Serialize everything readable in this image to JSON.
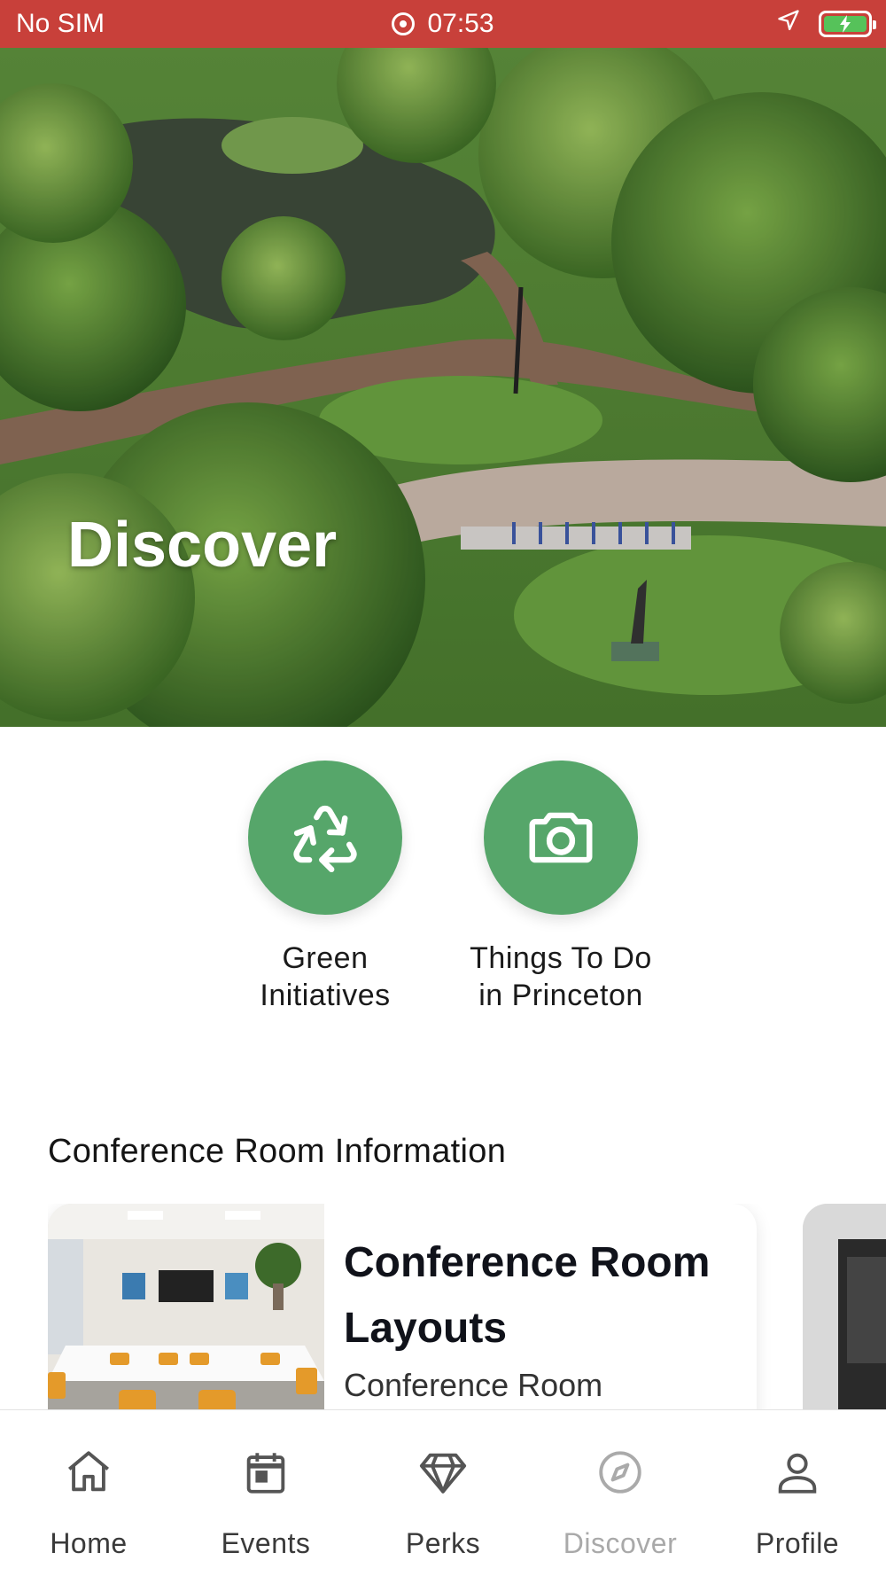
{
  "status_bar": {
    "carrier": "No SIM",
    "time": "07:53"
  },
  "hero": {
    "title": "Discover"
  },
  "quick_links": [
    {
      "label": "Green\nInitiatives",
      "icon": "recycle-icon"
    },
    {
      "label": "Things To Do\nin Princeton",
      "icon": "camera-icon"
    }
  ],
  "section": {
    "title": "Conference Room Information"
  },
  "cards": [
    {
      "title": "Conference Room Layouts",
      "subtitle": "Conference Room"
    }
  ],
  "tab_bar": {
    "items": [
      {
        "label": "Home",
        "icon": "home-icon"
      },
      {
        "label": "Events",
        "icon": "calendar-icon"
      },
      {
        "label": "Perks",
        "icon": "diamond-icon"
      },
      {
        "label": "Discover",
        "icon": "compass-icon",
        "active": true
      },
      {
        "label": "Profile",
        "icon": "person-icon"
      }
    ]
  },
  "colors": {
    "status_bar": "#c8403a",
    "accent_green": "#56a66a",
    "battery_green": "#56c25a",
    "inactive_tab": "#a9a9a9"
  }
}
